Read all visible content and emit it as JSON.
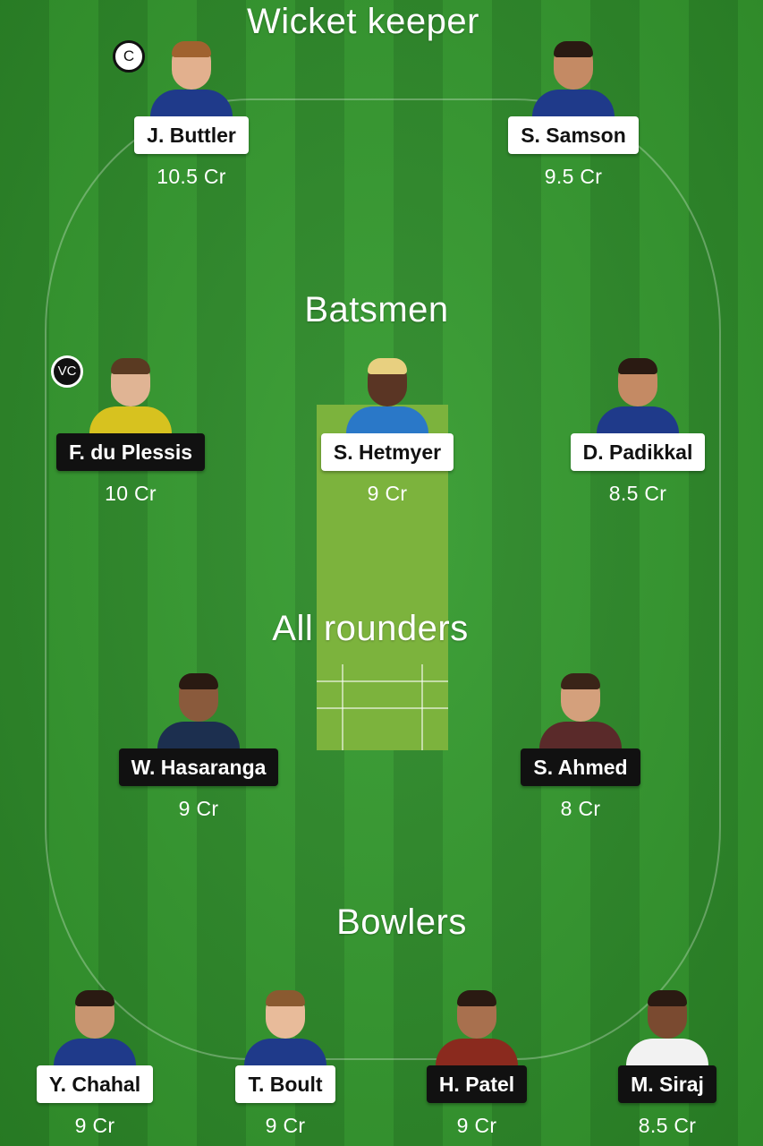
{
  "sections": {
    "wicket_keeper": "Wicket keeper",
    "batsmen": "Batsmen",
    "all_rounders": "All rounders",
    "bowlers": "Bowlers"
  },
  "badges": {
    "captain": "C",
    "vice_captain": "VC"
  },
  "colors": {
    "field_green": "#2f8f2a",
    "pitch": "#7cb33d",
    "light_tag": "#ffffff",
    "dark_tag": "#111111"
  },
  "players": {
    "buttler": {
      "name": "J. Buttler",
      "price": "10.5 Cr"
    },
    "samson": {
      "name": "S. Samson",
      "price": "9.5 Cr"
    },
    "duplessis": {
      "name": "F. du Plessis",
      "price": "10 Cr"
    },
    "hetmyer": {
      "name": "S. Hetmyer",
      "price": "9 Cr"
    },
    "padikkal": {
      "name": "D. Padikkal",
      "price": "8.5 Cr"
    },
    "hasaranga": {
      "name": "W. Hasaranga",
      "price": "9 Cr"
    },
    "ahmed": {
      "name": "S. Ahmed",
      "price": "8 Cr"
    },
    "chahal": {
      "name": "Y. Chahal",
      "price": "9 Cr"
    },
    "boult": {
      "name": "T. Boult",
      "price": "9 Cr"
    },
    "patel": {
      "name": "H. Patel",
      "price": "9 Cr"
    },
    "siraj": {
      "name": "M. Siraj",
      "price": "8.5 Cr"
    }
  }
}
